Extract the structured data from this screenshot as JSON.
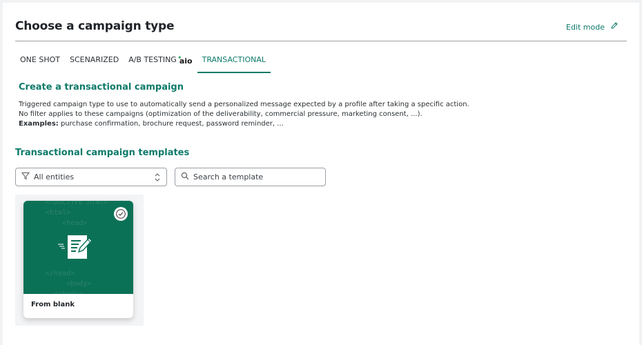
{
  "header": {
    "title": "Choose a campaign type",
    "edit_mode_label": "Edit mode",
    "edit_icon": "pencil-icon"
  },
  "tabs": [
    {
      "label": "ONE SHOT",
      "active": false
    },
    {
      "label": "SCENARIZED",
      "active": false
    },
    {
      "label": "A/B TESTING",
      "active": false,
      "badge": "aio"
    },
    {
      "label": "TRANSACTIONAL",
      "active": true
    }
  ],
  "section": {
    "title": "Create a transactional campaign",
    "line1": "Triggered campaign type to use to automatically send a personalized message expected by a profile after taking a specific action.",
    "line2": "No filter applies to these campaigns (optimization of the deliverability, commercial pressure, marketing consent, ...).",
    "examples_label": "Examples:",
    "examples_text": "purchase confirmation, brochure request, password reminder, ..."
  },
  "templates": {
    "title": "Transactional campaign templates",
    "filter": {
      "value": "All entities",
      "icon": "filter-icon"
    },
    "search": {
      "placeholder": "Search a template",
      "value": "",
      "icon": "search-icon"
    },
    "cards": [
      {
        "label": "From blank",
        "selected": true,
        "icon": "document-edit-icon"
      }
    ]
  },
  "colors": {
    "accent": "#0d7a6a",
    "card_bg": "#0b7156"
  }
}
